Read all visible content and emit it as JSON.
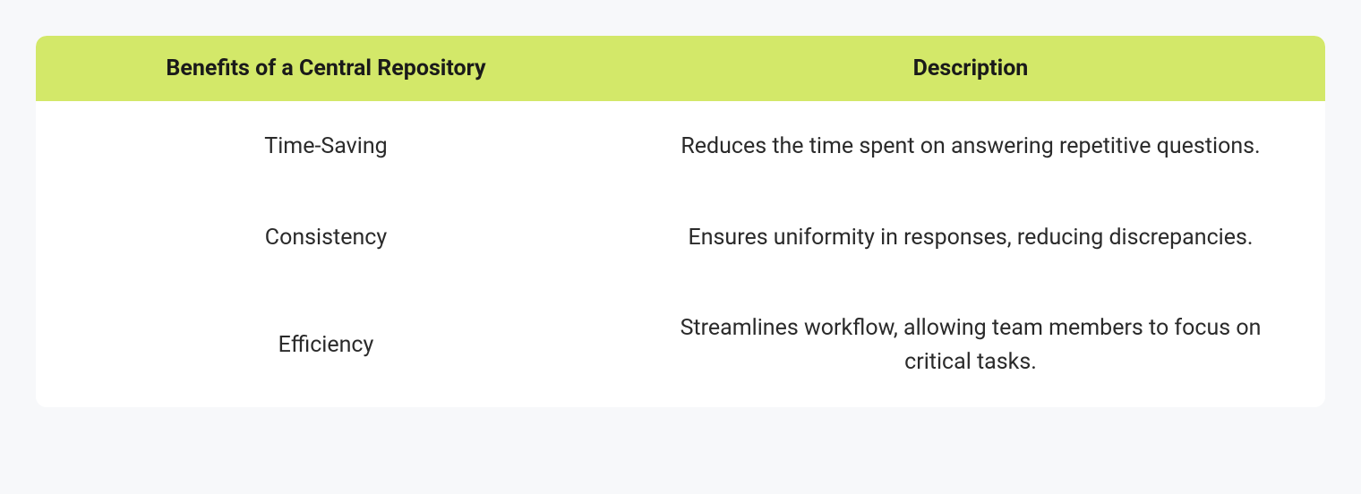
{
  "table": {
    "headers": {
      "col1": "Benefits of a Central Repository",
      "col2": "Description"
    },
    "rows": [
      {
        "benefit": "Time-Saving",
        "description": "Reduces the time spent on answering repetitive questions."
      },
      {
        "benefit": "Consistency",
        "description": "Ensures uniformity in responses, reducing discrepancies."
      },
      {
        "benefit": "Efficiency",
        "description": "Streamlines workflow, allowing team members to focus on critical tasks."
      }
    ]
  }
}
